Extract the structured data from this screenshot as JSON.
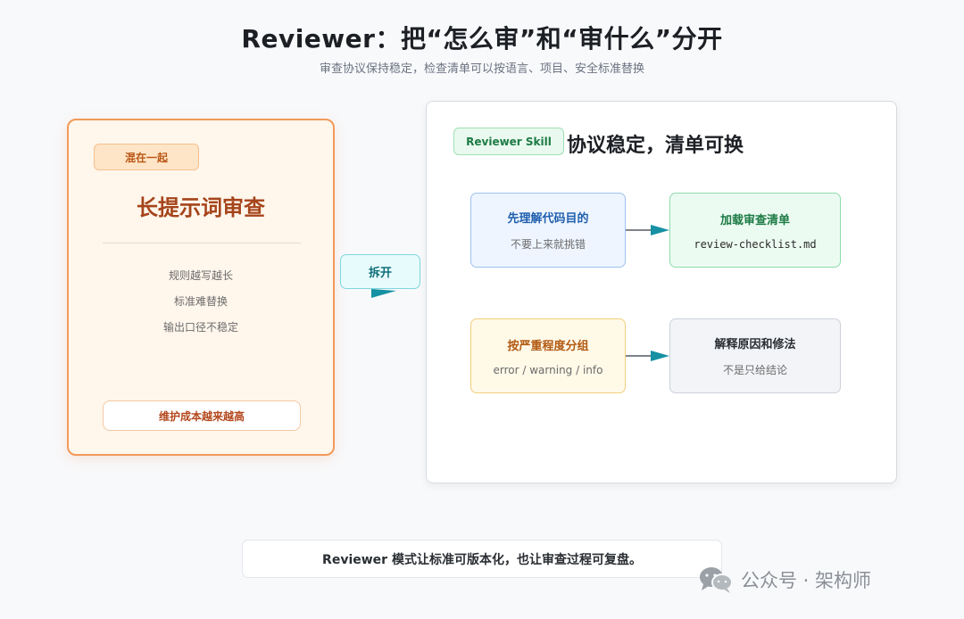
{
  "header": {
    "title": "Reviewer：把“怎么审”和“审什么”分开",
    "subtitle": "审查协议保持稳定，检查清单可以按语言、项目、安全标准替换"
  },
  "left_card": {
    "badge": "混在一起",
    "title": "长提示词审查",
    "items": [
      "规则越写越长",
      "标准难替换",
      "输出口径不稳定"
    ],
    "footer": "维护成本越来越高"
  },
  "split": {
    "label": "拆开"
  },
  "right_card": {
    "badge": "Reviewer Skill",
    "title": "协议稳定，清单可换",
    "nodes": [
      {
        "title": "先理解代码目的",
        "sub": "不要上来就挑错"
      },
      {
        "title": "加载审查清单",
        "sub": "review-checklist.md"
      },
      {
        "title": "按严重程度分组",
        "sub": "error / warning / info"
      },
      {
        "title": "解释原因和修法",
        "sub": "不是只给结论"
      }
    ]
  },
  "footer_note": "Reviewer 模式让标准可版本化，也让审查过程可复盘。",
  "watermark": {
    "text": "公众号 · 架构师"
  },
  "colors": {
    "left_border": "#f29a5a",
    "arrow": "#1591a3",
    "skill_green": "#1c7a44"
  }
}
